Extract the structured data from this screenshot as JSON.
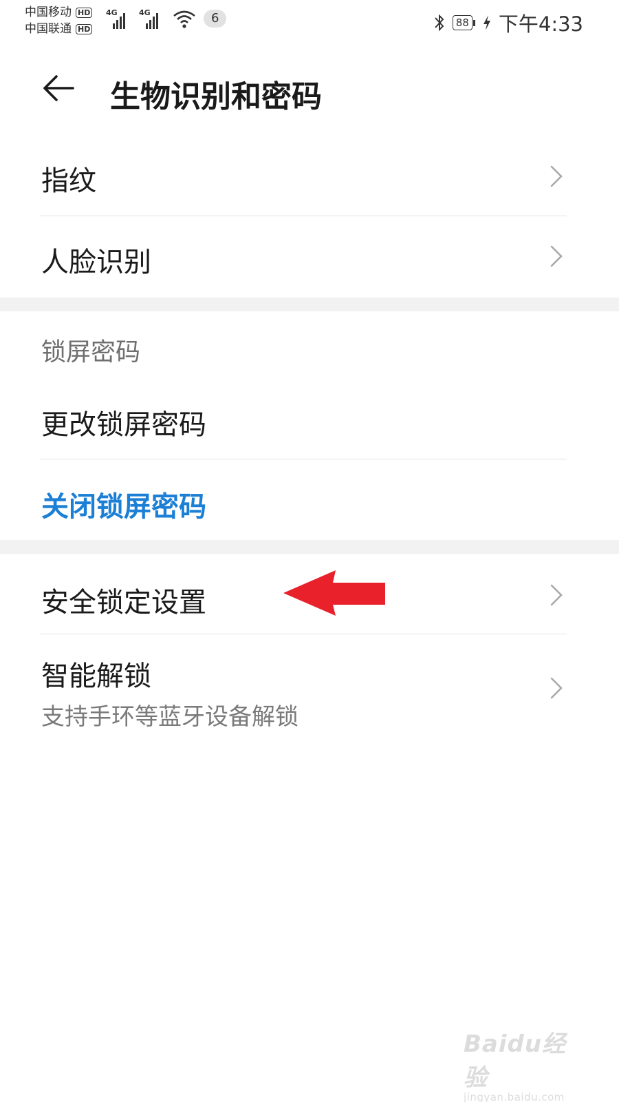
{
  "status_bar": {
    "carrier1": "中国移动",
    "carrier2": "中国联通",
    "hd_label": "HD",
    "network1": "4G",
    "network2": "4G",
    "notification_count": "6",
    "battery_level": "88",
    "time": "下午4:33"
  },
  "header": {
    "title": "生物识别和密码"
  },
  "biometrics": {
    "fingerprint_label": "指纹",
    "face_recognition_label": "人脸识别"
  },
  "lock_screen": {
    "section_title": "锁屏密码",
    "change_password_label": "更改锁屏密码",
    "disable_password_label": "关闭锁屏密码",
    "accent_color": "#1b7fd6"
  },
  "security": {
    "security_lock_label": "安全锁定设置",
    "smart_unlock_label": "智能解锁",
    "smart_unlock_sub": "支持手环等蓝牙设备解锁"
  },
  "annotation": {
    "arrow_color": "#e8212b"
  },
  "watermark": {
    "logo": "Baidu经验",
    "url": "jingyan.baidu.com"
  }
}
